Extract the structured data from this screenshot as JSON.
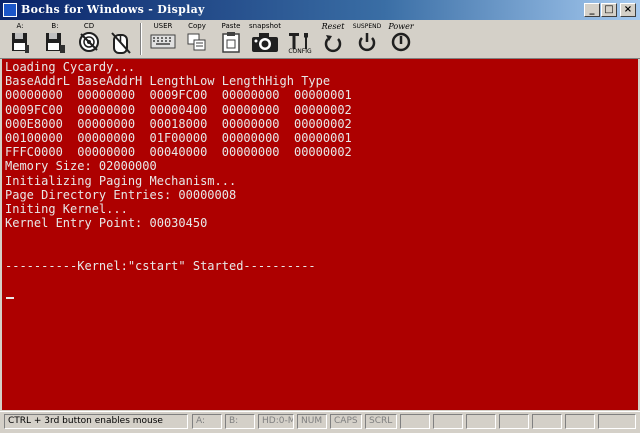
{
  "window": {
    "title": "Bochs for Windows - Display"
  },
  "title_buttons": {
    "minimize": "_",
    "maximize": "□",
    "close": "×"
  },
  "toolbar": {
    "floppy_a": "A:",
    "floppy_b": "B:",
    "cdrom": "CD",
    "user": "USER",
    "copy": "Copy",
    "paste": "Paste",
    "snapshot": "snapshot",
    "config": "CONFIG",
    "reset": "Reset",
    "suspend": "SUSPEND",
    "power": "Power"
  },
  "console": {
    "lines": [
      "Loading Cycardy...",
      "BaseAddrL BaseAddrH LengthLow LengthHigh Type",
      "00000000  00000000  0009FC00  00000000  00000001",
      "0009FC00  00000000  00000400  00000000  00000002",
      "000E8000  00000000  00018000  00000000  00000002",
      "00100000  00000000  01F00000  00000000  00000001",
      "FFFC0000  00000000  00040000  00000000  00000002",
      "Memory Size: 02000000",
      "Initializing Paging Mechanism...",
      "Page Directory Entries: 00000008",
      "Initing Kernel...",
      "Kernel Entry Point: 00030450",
      "",
      "",
      "----------Kernel:\"cstart\" Started----------"
    ],
    "background": "#ad0000",
    "foreground": "#e8e8e8"
  },
  "statusbar": {
    "mouse_hint": "CTRL + 3rd button enables mouse",
    "a": "A:",
    "b": "B:",
    "hd": "HD:0-M",
    "num": "NUM",
    "caps": "CAPS",
    "scrl": "SCRL"
  }
}
